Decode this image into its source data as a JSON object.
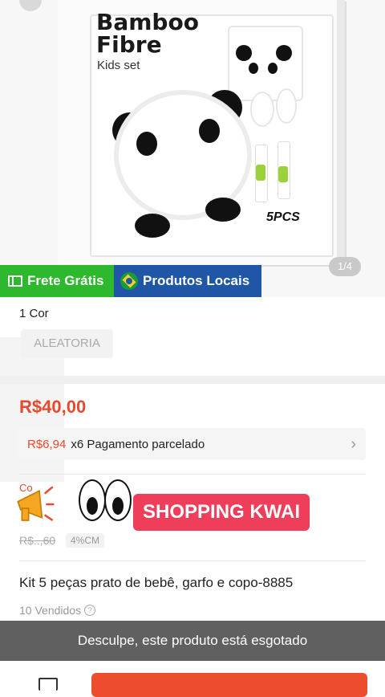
{
  "product_image": {
    "brand_line1": "Bamboo",
    "brand_line2": "Fibre",
    "brand_sub": "Kids set",
    "pieces_label": "5PCS",
    "image_counter": "1/4"
  },
  "badges": {
    "frete": "Frete Grátis",
    "local": "Produtos Locais"
  },
  "variant": {
    "title": "1 Cor",
    "option": "ALEATORIA"
  },
  "price": {
    "current": "R$40,00",
    "installment_value": "R$6,94",
    "installment_text": "x6 Pagamento parcelado"
  },
  "promo": {
    "coupon_partial": "Co",
    "old_price_partial": "R$..,60",
    "discount": "4%CM"
  },
  "product": {
    "title": "Kit 5 peças prato de bebê, garfo e copo-8885",
    "sold": "10 Vendidos"
  },
  "overlay": {
    "label": "SHOPPING KWAI"
  },
  "notice": {
    "sold_out": "Desculpe, este produto está esgotado"
  },
  "colors": {
    "price_red": "#e8492e",
    "frete_green": "#2eb82e",
    "local_blue": "#1f56a6",
    "kwai_pink": "#ef3e5a",
    "buy_orange": "#ee4d2d"
  }
}
